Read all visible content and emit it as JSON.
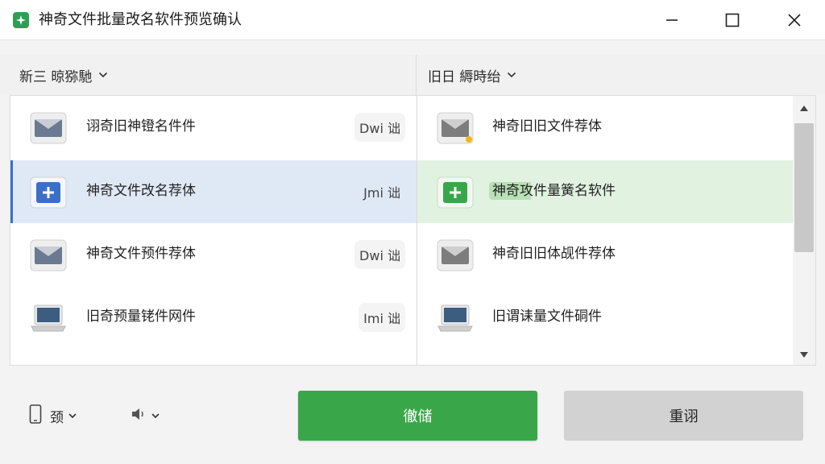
{
  "window": {
    "title": "神奇文件批量改名软件预览确认",
    "controls": [
      "minimize",
      "maximize",
      "close"
    ]
  },
  "columns": {
    "left_header": "新三 晾猕馳",
    "right_header": "旧日 縟時绐"
  },
  "rows_left": [
    {
      "name": "诩奇旧神镫名件件",
      "tag": "Dwi 诎",
      "icon": "image-file-icon",
      "selected": false
    },
    {
      "name": "神奇文件改名荐体",
      "tag": "Jmi 诎",
      "icon": "plus-file-icon",
      "selected": true
    },
    {
      "name": "神奇文件预件荐体",
      "tag": "Dwi 诎",
      "icon": "image-file-icon",
      "selected": false
    },
    {
      "name": "旧奇预量铑件网件",
      "tag": "Imi 诎",
      "icon": "laptop-file-icon",
      "selected": false
    }
  ],
  "rows_right": [
    {
      "name": "神奇旧旧文件荐体",
      "icon": "image-file-warning-icon",
      "selected": false
    },
    {
      "name": "神奇攻件量簧名软件",
      "icon": "plus-file-icon",
      "selected": true
    },
    {
      "name": "神奇旧旧体觇件荐体",
      "icon": "image-file-icon",
      "selected": false
    },
    {
      "name": "旧谓诔量文件硐件",
      "icon": "laptop-file-icon",
      "selected": false
    }
  ],
  "footer": {
    "device_label": "颈",
    "sound_label": "",
    "primary_button": "徹储",
    "secondary_button": "重诩"
  },
  "colors": {
    "primary": "#3aa64a",
    "selection_left": "#dfe9f6",
    "selection_right": "#e2f2e1",
    "accent_blue": "#3c6fc4"
  }
}
